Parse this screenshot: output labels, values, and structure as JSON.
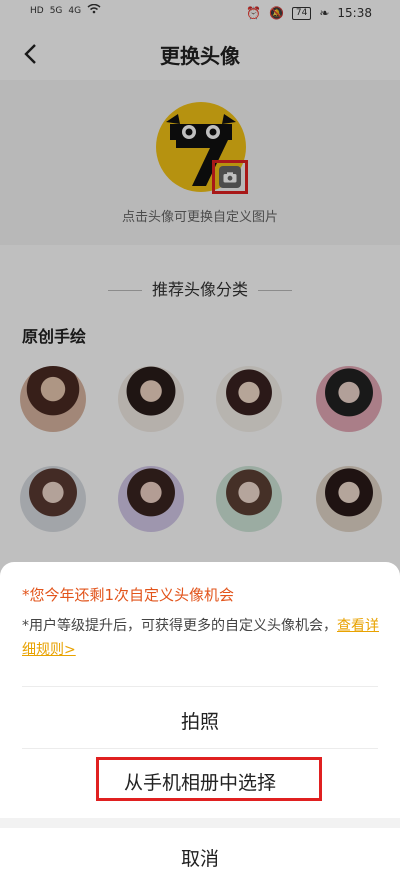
{
  "status_bar": {
    "time": "15:38",
    "battery": "74",
    "signal_labels": [
      "HD",
      "5G",
      "4G"
    ]
  },
  "nav": {
    "title": "更换头像",
    "back_icon": "chevron-left-icon"
  },
  "avatar": {
    "hint": "点击头像可更换自定义图片",
    "camera_icon": "camera-icon"
  },
  "recommend": {
    "section_title": "推荐头像分类",
    "category": "原创手绘",
    "avatar_count": 8
  },
  "sheet": {
    "warn": "*您今年还剩1次自定义头像机会",
    "info": "*用户等级提升后，可获得更多的自定义头像机会，",
    "rules_link": "查看详细规则>",
    "take_photo": "拍照",
    "choose_album": "从手机相册中选择",
    "cancel": "取消"
  },
  "colors": {
    "accent_orange": "#e2541b",
    "link_yellow": "#e8a200",
    "highlight_red": "#e02020",
    "avatar_yellow": "#f3c316"
  }
}
